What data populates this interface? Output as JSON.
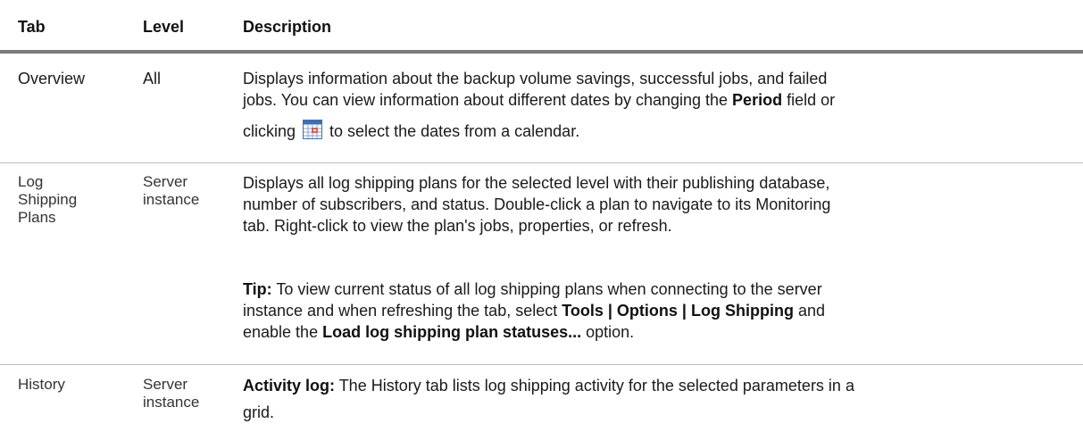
{
  "table": {
    "headers": {
      "tab": "Tab",
      "level": "Level",
      "description": "Description"
    },
    "rows": [
      {
        "tab": "Overview",
        "level": "All",
        "desc_a1": "Displays information about the backup volume savings, successful jobs, and failed",
        "desc_a2": "jobs. You can view information about different dates by changing the ",
        "desc_a2_bold": "Period",
        "desc_a2_tail": " field or",
        "desc_a3_pre": "clicking ",
        "desc_a3_post": " to select the dates from a calendar.",
        "icon": "calendar-icon"
      },
      {
        "tab_line1": "Log",
        "tab_line2": "Shipping",
        "tab_line3": "Plans",
        "level_line1": "Server",
        "level_line2": "instance",
        "desc_b1": "Displays all log shipping plans for the selected level with their publishing database,",
        "desc_b2": "number of subscribers, and status. Double-click a plan to navigate to its Monitoring",
        "desc_b3": "tab. Right-click to view the plan's jobs, properties, or refresh.",
        "tip_label": "Tip:",
        "tip1_rest": " To view current status of all log shipping plans when connecting to the server",
        "tip2_pre": "instance and when refreshing the tab, select ",
        "tip2_bold": "Tools | Options | Log Shipping",
        "tip2_post": " and",
        "tip3_pre": "enable the ",
        "tip3_bold": "Load log shipping plan statuses...",
        "tip3_post": " option."
      },
      {
        "tab": "History",
        "level_line1": "Server",
        "level_line2": "instance",
        "activity_label": "Activity log:",
        "activity_rest": " The History tab lists log shipping activity for the selected parameters in a",
        "activity_line2": "grid."
      }
    ]
  }
}
